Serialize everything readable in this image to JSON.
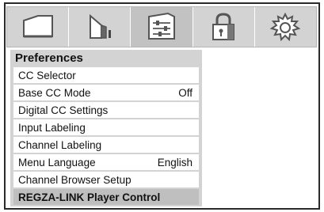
{
  "icon_bar": {
    "icons": [
      {
        "name": "picture-icon",
        "selected": false
      },
      {
        "name": "sound-icon",
        "selected": false
      },
      {
        "name": "preferences-icon",
        "selected": true
      },
      {
        "name": "lock-icon",
        "selected": false
      },
      {
        "name": "setup-icon",
        "selected": false
      }
    ]
  },
  "panel": {
    "title": "Preferences",
    "items": [
      {
        "label": "CC Selector",
        "value": ""
      },
      {
        "label": "Base CC Mode",
        "value": "Off"
      },
      {
        "label": "Digital CC Settings",
        "value": ""
      },
      {
        "label": "Input Labeling",
        "value": ""
      },
      {
        "label": "Channel Labeling",
        "value": ""
      },
      {
        "label": "Menu Language",
        "value": "English"
      },
      {
        "label": "Channel Browser Setup",
        "value": ""
      },
      {
        "label": "REGZA-LINK Player Control",
        "value": "",
        "highlighted": true
      }
    ]
  },
  "colors": {
    "panel_background": "#d3d3d3",
    "highlight": "#bfbfbf",
    "border": "#2a2a2a"
  }
}
